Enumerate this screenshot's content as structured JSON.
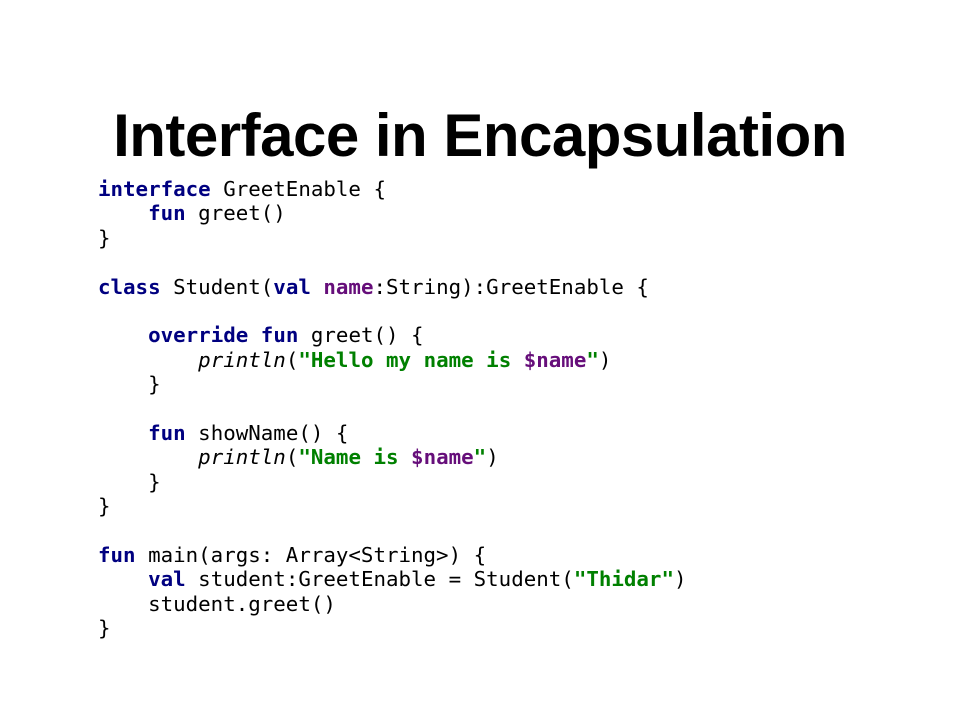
{
  "slide": {
    "title": "Interface in Encapsulation"
  },
  "colors": {
    "keyword": "#000080",
    "property": "#660e7a",
    "string": "#008000",
    "text": "#000000",
    "background": "#ffffff"
  },
  "code": {
    "language": "kotlin",
    "lines": [
      [
        {
          "t": "interface",
          "k": "kw"
        },
        {
          "t": " GreetEnable {",
          "k": "plain"
        }
      ],
      [
        {
          "t": "    ",
          "k": "plain"
        },
        {
          "t": "fun",
          "k": "kw"
        },
        {
          "t": " greet()",
          "k": "plain"
        }
      ],
      [
        {
          "t": "}",
          "k": "plain"
        }
      ],
      [],
      [
        {
          "t": "class",
          "k": "kw"
        },
        {
          "t": " Student(",
          "k": "plain"
        },
        {
          "t": "val",
          "k": "kw"
        },
        {
          "t": " ",
          "k": "plain"
        },
        {
          "t": "name",
          "k": "prop"
        },
        {
          "t": ":String):GreetEnable {",
          "k": "plain"
        }
      ],
      [],
      [
        {
          "t": "    ",
          "k": "plain"
        },
        {
          "t": "override",
          "k": "kw"
        },
        {
          "t": " ",
          "k": "plain"
        },
        {
          "t": "fun",
          "k": "kw"
        },
        {
          "t": " greet() {",
          "k": "plain"
        }
      ],
      [
        {
          "t": "        ",
          "k": "plain"
        },
        {
          "t": "println",
          "k": "call"
        },
        {
          "t": "(",
          "k": "plain"
        },
        {
          "t": "\"Hello my name is ",
          "k": "str"
        },
        {
          "t": "$name",
          "k": "tpl"
        },
        {
          "t": "\"",
          "k": "str"
        },
        {
          "t": ")",
          "k": "plain"
        }
      ],
      [
        {
          "t": "    }",
          "k": "plain"
        }
      ],
      [],
      [
        {
          "t": "    ",
          "k": "plain"
        },
        {
          "t": "fun",
          "k": "kw"
        },
        {
          "t": " showName() {",
          "k": "plain"
        }
      ],
      [
        {
          "t": "        ",
          "k": "plain"
        },
        {
          "t": "println",
          "k": "call"
        },
        {
          "t": "(",
          "k": "plain"
        },
        {
          "t": "\"Name is ",
          "k": "str"
        },
        {
          "t": "$name",
          "k": "tpl"
        },
        {
          "t": "\"",
          "k": "str"
        },
        {
          "t": ")",
          "k": "plain"
        }
      ],
      [
        {
          "t": "    }",
          "k": "plain"
        }
      ],
      [
        {
          "t": "}",
          "k": "plain"
        }
      ],
      [],
      [
        {
          "t": "fun",
          "k": "kw"
        },
        {
          "t": " main(args: Array<String>) {",
          "k": "plain"
        }
      ],
      [
        {
          "t": "    ",
          "k": "plain"
        },
        {
          "t": "val",
          "k": "kw"
        },
        {
          "t": " student:GreetEnable = Student(",
          "k": "plain"
        },
        {
          "t": "\"Thidar\"",
          "k": "str"
        },
        {
          "t": ")",
          "k": "plain"
        }
      ],
      [
        {
          "t": "    student.greet()",
          "k": "plain"
        }
      ],
      [
        {
          "t": "}",
          "k": "plain"
        }
      ]
    ]
  }
}
